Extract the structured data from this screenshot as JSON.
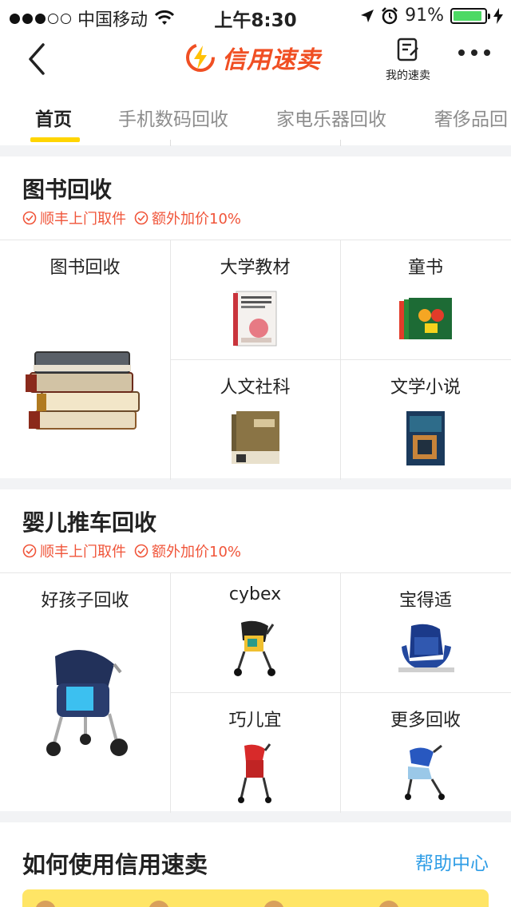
{
  "status_bar": {
    "carrier": "中国移动",
    "time": "上午8:30",
    "battery": "91%",
    "battery_level": 0.91
  },
  "nav": {
    "brand": "信用速卖",
    "my_sales_label": "我的速卖"
  },
  "tabs": [
    {
      "label": "首页",
      "active": true
    },
    {
      "label": "手机数码回收",
      "active": false
    },
    {
      "label": "家电乐器回收",
      "active": false
    },
    {
      "label": "奢侈品回",
      "active": false
    }
  ],
  "books": {
    "title": "图书回收",
    "perks": [
      "顺丰上门取件",
      "额外加价10%"
    ],
    "items": [
      {
        "label": "图书回收",
        "image": "book-stack"
      },
      {
        "label": "大学教材",
        "image": "textbook"
      },
      {
        "label": "童书",
        "image": "children-book"
      },
      {
        "label": "人文社科",
        "image": "humanities-book"
      },
      {
        "label": "文学小说",
        "image": "novel-book"
      }
    ]
  },
  "strollers": {
    "title": "婴儿推车回收",
    "perks": [
      "顺丰上门取件",
      "额外加价10%"
    ],
    "items": [
      {
        "label": "好孩子回收",
        "image": "navy-stroller"
      },
      {
        "label": "cybex",
        "image": "cybex-stroller"
      },
      {
        "label": "宝得适",
        "image": "car-seat"
      },
      {
        "label": "巧儿宜",
        "image": "red-stroller"
      },
      {
        "label": "更多回收",
        "image": "blue-stroller"
      }
    ]
  },
  "howto": {
    "title": "如何使用信用速卖",
    "help_link": "帮助中心"
  },
  "colors": {
    "accent_yellow": "#ffd500",
    "brand_orange": "#f04f23",
    "perk_red": "#f0553a",
    "link_blue": "#2e9de6",
    "battery_green": "#4cd964"
  }
}
